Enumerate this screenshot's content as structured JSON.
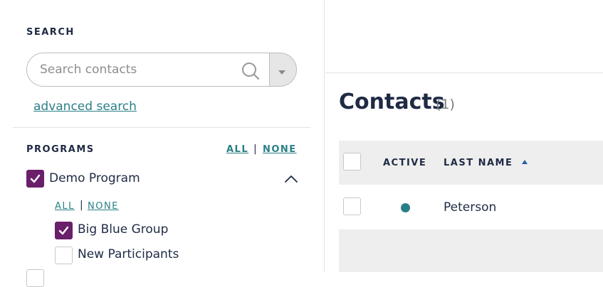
{
  "sidebar": {
    "search_heading": "SEARCH",
    "search_placeholder": "Search contacts",
    "advanced_search": "advanced search",
    "programs_heading": "PROGRAMS",
    "programs_all": "ALL",
    "programs_none": "NONE",
    "programs": [
      {
        "label": "Demo Program",
        "checked": true,
        "expanded": true,
        "all": "ALL",
        "none": "NONE",
        "groups": [
          {
            "label": "Big Blue Group",
            "checked": true
          },
          {
            "label": "New Participants",
            "checked": false
          }
        ]
      }
    ]
  },
  "main": {
    "title": "Contacts",
    "count": "(1)",
    "table": {
      "columns": [
        "ACTIVE",
        "LAST NAME"
      ],
      "sort_column": "LAST NAME",
      "rows": [
        {
          "active": true,
          "last_name": "Peterson"
        }
      ]
    }
  },
  "colors": {
    "accent": "#2a7f86",
    "checkbox": "#6a1f6b",
    "text": "#1f2a44"
  }
}
